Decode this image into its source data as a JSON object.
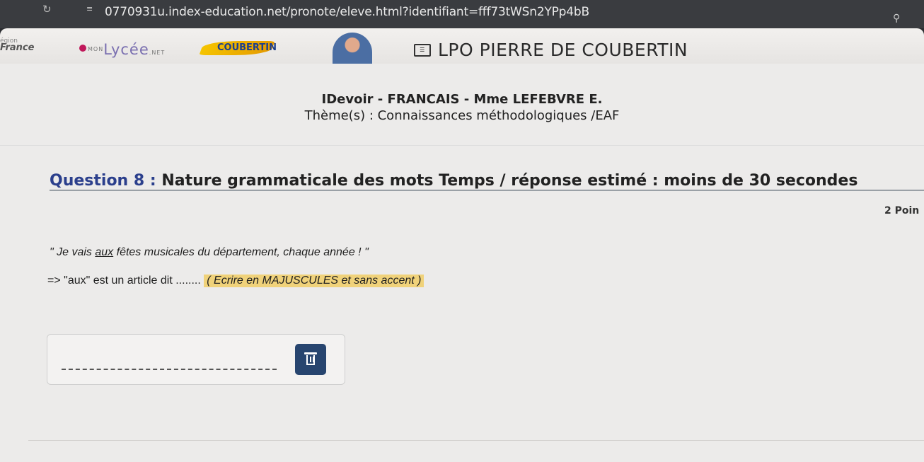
{
  "browser": {
    "url": "0770931u.index-education.net/pronote/eleve.html?identifiant=fff73tWSn2YPp4bB"
  },
  "header": {
    "region_logo_small": "égion",
    "region_logo_big": "France",
    "lycee_logo_mon": "MON",
    "lycee_logo": "Lycée",
    "lycee_logo_net": ".NET",
    "coubertin_logo": "COUBERTIN",
    "school_name": "LPO PIERRE DE COUBERTIN"
  },
  "assignment": {
    "title": "IDevoir - FRANCAIS - Mme LEFEBVRE E.",
    "theme": "Thème(s) : Connaissances méthodologiques /EAF"
  },
  "question": {
    "number_label": "Question 8 :",
    "text": "Nature grammaticale des mots Temps / réponse estimé : moins de 30 secondes",
    "points": "2 Poin",
    "sentence_before": "\" Je vais ",
    "sentence_underlined": "aux",
    "sentence_after": " fêtes musicales du département, chaque année ! \"",
    "prompt": "=> \"aux\" est un article dit ........ ",
    "hint": "( Ecrire en MAJUSCULES et sans accent )"
  },
  "answer": {
    "value": "",
    "delete_icon": "trash-icon"
  },
  "colors": {
    "accent": "#27456f",
    "question_number": "#2b3f8c",
    "highlight": "#f0d27a"
  }
}
